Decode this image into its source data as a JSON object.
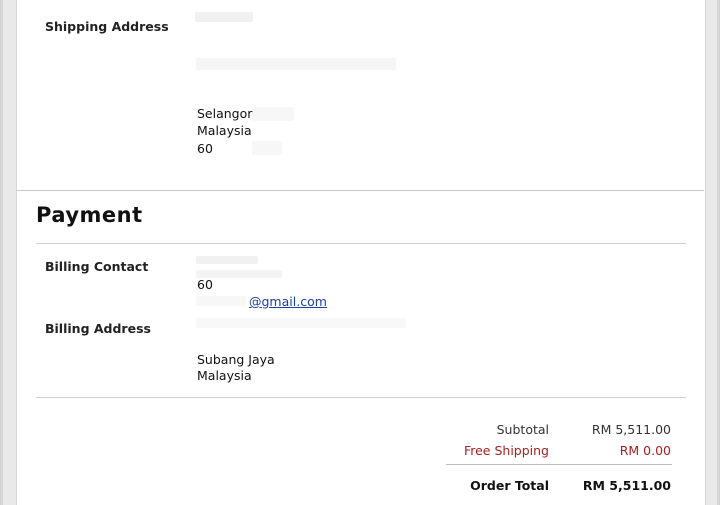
{
  "shipping": {
    "label": "Shipping Address",
    "lines": [
      "Selangor",
      "Malaysia",
      "60"
    ]
  },
  "payment": {
    "title": "Payment",
    "billing_contact_label": "Billing Contact",
    "contact_phone": "60",
    "contact_email": "@gmail.com",
    "billing_address_label": "Billing Address",
    "address_lines": [
      "Subang Jaya",
      "Malaysia"
    ]
  },
  "totals": {
    "subtotal_label": "Subtotal",
    "subtotal_value": "RM 5,511.00",
    "shipping_label": "Free Shipping",
    "shipping_value": "RM 0.00",
    "order_total_label": "Order Total",
    "order_total_value": "RM 5,511.00"
  },
  "colors": {
    "accent_red": "#a52020",
    "link_blue": "#1a3fa6"
  }
}
